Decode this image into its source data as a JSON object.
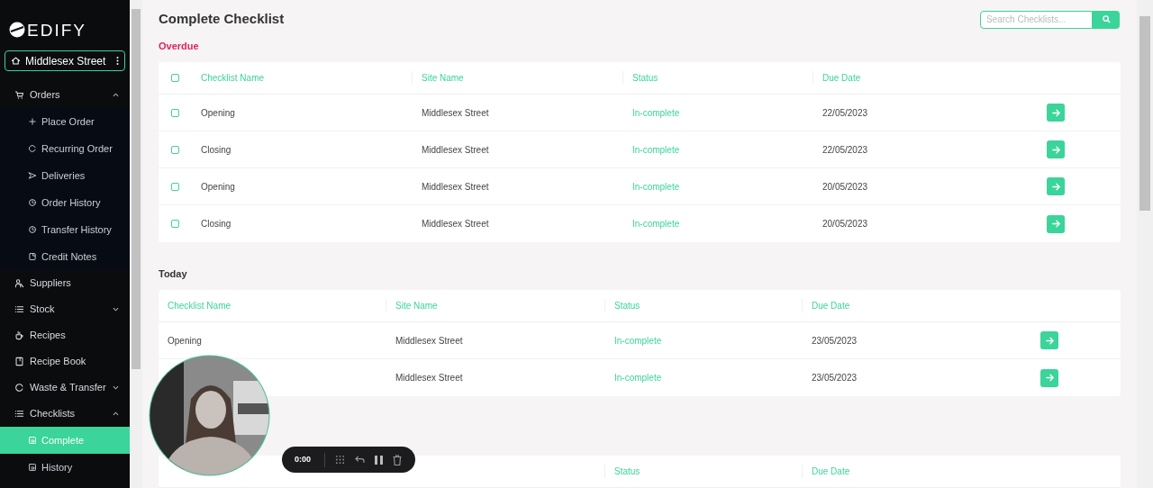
{
  "sidebar": {
    "logo": "EDIFY",
    "site": "Middlesex Street",
    "items": [
      {
        "label": "Orders",
        "expanded": true,
        "selected": false,
        "children": [
          {
            "label": "Place Order",
            "selected": false
          },
          {
            "label": "Recurring Order",
            "selected": false
          },
          {
            "label": "Deliveries",
            "selected": false
          },
          {
            "label": "Order History",
            "selected": false
          },
          {
            "label": "Transfer History",
            "selected": false
          },
          {
            "label": "Credit Notes",
            "selected": false
          }
        ]
      },
      {
        "label": "Suppliers",
        "selected": false
      },
      {
        "label": "Stock",
        "expanded": false,
        "selected": false
      },
      {
        "label": "Recipes",
        "selected": false
      },
      {
        "label": "Recipe Book",
        "selected": false
      },
      {
        "label": "Waste & Transfer",
        "expanded": false,
        "selected": false
      },
      {
        "label": "Checklists",
        "expanded": true,
        "selected": false,
        "children": [
          {
            "label": "Complete",
            "selected": true
          },
          {
            "label": "History",
            "selected": false
          }
        ]
      }
    ]
  },
  "page": {
    "title": "Complete Checklist",
    "search": {
      "placeholder": "Search Checklists..."
    }
  },
  "sections": [
    {
      "title": "Overdue",
      "kind": "overdue",
      "all_checked": false,
      "columns": [
        "Checklist Name",
        "Site Name",
        "Status",
        "Due Date"
      ],
      "rows": [
        {
          "checked": false,
          "cells": [
            "Opening",
            "Middlesex Street",
            "In-complete",
            "22/05/2023"
          ]
        },
        {
          "checked": false,
          "cells": [
            "Closing",
            "Middlesex Street",
            "In-complete",
            "22/05/2023"
          ]
        },
        {
          "checked": false,
          "cells": [
            "Opening",
            "Middlesex Street",
            "In-complete",
            "20/05/2023"
          ]
        },
        {
          "checked": false,
          "cells": [
            "Closing",
            "Middlesex Street",
            "In-complete",
            "20/05/2023"
          ]
        }
      ]
    },
    {
      "title": "Today",
      "kind": "normal",
      "columns": [
        "Checklist Name",
        "Site Name",
        "Status",
        "Due Date"
      ],
      "rows": [
        {
          "cells": [
            "Opening",
            "Middlesex Street",
            "In-complete",
            "23/05/2023"
          ]
        },
        {
          "cells": [
            "",
            "Middlesex Street",
            "In-complete",
            "23/05/2023"
          ]
        }
      ]
    },
    {
      "kind": "partial",
      "columns": [
        "",
        "",
        "Status",
        "Due Date"
      ]
    }
  ],
  "recorder": {
    "time": "0:00"
  }
}
